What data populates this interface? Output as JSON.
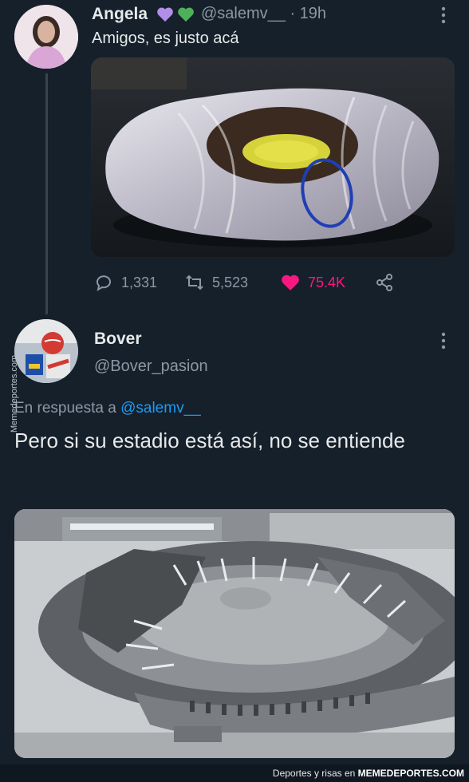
{
  "tweet1": {
    "display_name": "Angela",
    "handle": "@salemv__",
    "time": "· 19h",
    "text": "Amigos, es justo acá",
    "image": "stadium-aerial-photo",
    "stats": {
      "replies": "1,331",
      "retweets": "5,523",
      "likes": "75.4K"
    },
    "colors": {
      "like": "#f91880",
      "purple_heart": "#b18ee8",
      "green_heart": "#4fb05c"
    }
  },
  "tweet2": {
    "display_name": "Bover",
    "handle": "@Bover_pasion",
    "reply_prefix": "En respuesta a",
    "reply_mention": "@salemv__",
    "text": "Pero si su estadio está así, no se entiende",
    "image": "collapsed-stadium-photo"
  },
  "watermark": {
    "side": "Memedeportes.com",
    "bottom_prefix": "Deportes y risas en",
    "bottom_brand": "MEMEDEPORTES.COM"
  },
  "theme": {
    "background": "#15202b",
    "text": "#e7e9ea",
    "muted": "#8b98a5",
    "link": "#1d9bf0"
  }
}
